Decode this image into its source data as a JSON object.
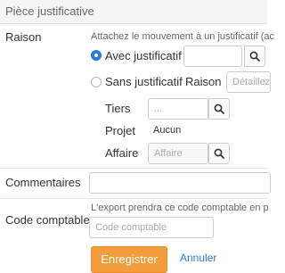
{
  "section": {
    "title": "Pièce justificative"
  },
  "reason": {
    "label": "Raison",
    "help": "Attachez le mouvement à un justificatif (ac",
    "option_with": "Avec justificatif",
    "option_with_selected": true,
    "option_without": "Sans justificatif",
    "sub_label": "Raison",
    "sub_placeholder": "Détaillez"
  },
  "tiers": {
    "label": "Tiers",
    "placeholder": "..."
  },
  "project": {
    "label": "Projet",
    "value": "Aucun"
  },
  "affaire": {
    "label": "Affaire",
    "placeholder": "Affaire"
  },
  "comments": {
    "label": "Commentaires",
    "value": ""
  },
  "accounting": {
    "help": "L'export prendra ce code comptable en p",
    "label": "Code comptable",
    "placeholder": "Code comptable"
  },
  "actions": {
    "save_label": "Enregistrer",
    "cancel_label": "Annuler"
  },
  "colors": {
    "accent": "#2a7ad8",
    "primary_button": "#f39c3c"
  }
}
